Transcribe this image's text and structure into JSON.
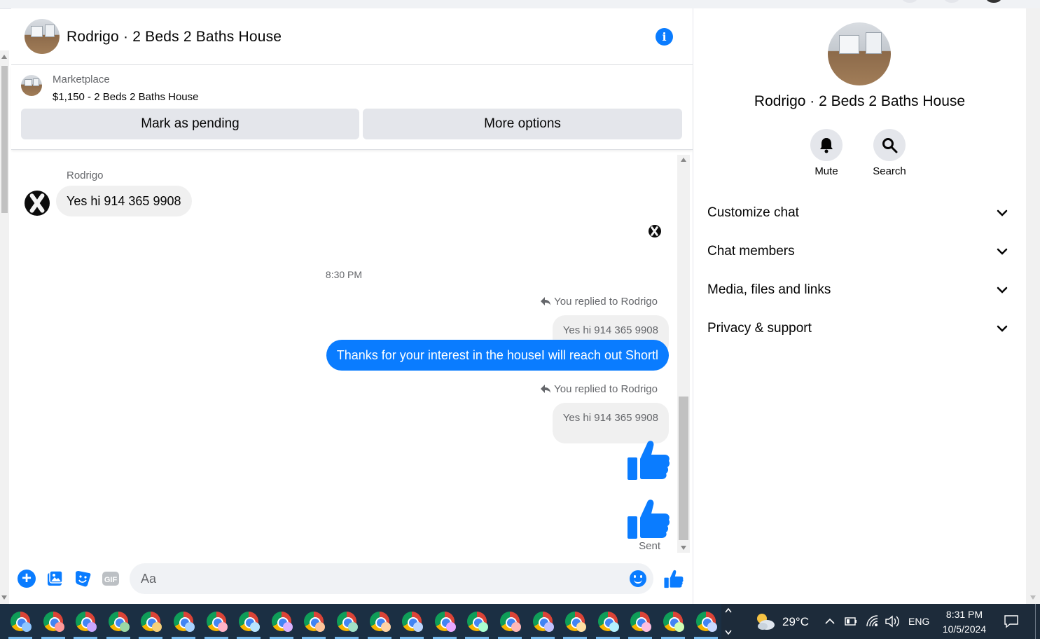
{
  "chat": {
    "title": "Rodrigo · 2 Beds 2 Baths House",
    "marketplace": {
      "label": "Marketplace",
      "listing": "$1,150 - 2 Beds 2 Baths House",
      "mark_pending": "Mark as pending",
      "more_options": "More options"
    },
    "messages": {
      "sender_name": "Rodrigo",
      "incoming_text": "Yes hi 914 365 9908",
      "timestamp": "8:30 PM",
      "reply1_label": "You replied to Rodrigo",
      "reply1_quote": "Yes hi 914 365 9908",
      "outgoing_text": "Thanks for your interest in the houseI will reach out Shortl",
      "reply2_label": "You replied to Rodrigo",
      "reply2_quote": "Yes hi 914 365 9908",
      "status": "Sent"
    },
    "composer": {
      "placeholder": "Aa"
    }
  },
  "panel": {
    "title": "Rodrigo · 2 Beds 2 Baths House",
    "actions": [
      {
        "label": "Mute",
        "icon": "bell-icon"
      },
      {
        "label": "Search",
        "icon": "search-icon"
      }
    ],
    "sections": [
      {
        "label": "Customize chat"
      },
      {
        "label": "Chat members"
      },
      {
        "label": "Media, files and links"
      },
      {
        "label": "Privacy & support"
      }
    ]
  },
  "taskbar": {
    "temperature": "29°C",
    "language": "ENG",
    "time": "8:31 PM",
    "date": "10/5/2024"
  },
  "colors": {
    "accent": "#0a7cff",
    "bubble_in": "#f0f0f0",
    "button_bg": "#e4e6eb",
    "taskbar": "#1b2f43"
  }
}
